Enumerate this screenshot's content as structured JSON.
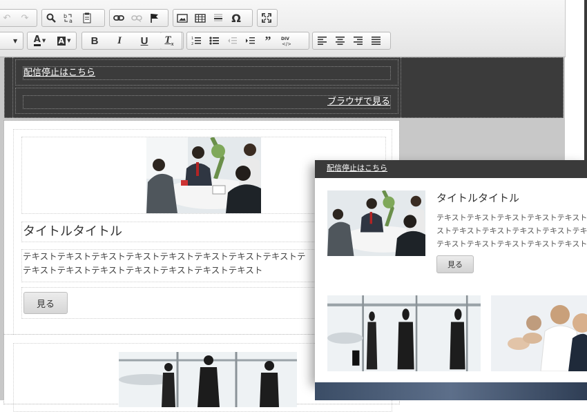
{
  "toolbar": {
    "row1": [
      {
        "name": "undo-button",
        "icon": "undo-icon",
        "glyph": "↶",
        "disabled": true
      },
      {
        "name": "redo-button",
        "icon": "redo-icon",
        "glyph": "↷",
        "disabled": true
      },
      {
        "name": "find-button",
        "icon": "search-icon",
        "glyph": "search"
      },
      {
        "name": "replace-button",
        "icon": "replace-icon",
        "glyph": "b→a"
      },
      {
        "name": "paste-from-word-button",
        "icon": "paste-icon",
        "glyph": "paste"
      },
      {
        "name": "link-button",
        "icon": "link-icon",
        "glyph": "link"
      },
      {
        "name": "unlink-button",
        "icon": "unlink-icon",
        "glyph": "unlink",
        "disabled": true
      },
      {
        "name": "anchor-button",
        "icon": "flag-icon",
        "glyph": "flag"
      },
      {
        "name": "image-button",
        "icon": "image-icon",
        "glyph": "image"
      },
      {
        "name": "table-button",
        "icon": "table-icon",
        "glyph": "table"
      },
      {
        "name": "horizontal-rule-button",
        "icon": "horizontal-rule-icon",
        "glyph": "hr"
      },
      {
        "name": "special-char-button",
        "icon": "omega-icon",
        "glyph": "Ω"
      },
      {
        "name": "maximize-button",
        "icon": "maximize-icon",
        "glyph": "max"
      }
    ],
    "row2": [
      {
        "name": "text-color-button",
        "icon": "text-color-icon",
        "glyph": "A",
        "dropdown": true
      },
      {
        "name": "bg-color-button",
        "icon": "bg-color-icon",
        "glyph": "A",
        "dropdown": true
      },
      {
        "name": "bold-button",
        "icon": "bold-icon",
        "glyph": "B"
      },
      {
        "name": "italic-button",
        "icon": "italic-icon",
        "glyph": "I"
      },
      {
        "name": "underline-button",
        "icon": "underline-icon",
        "glyph": "U"
      },
      {
        "name": "strike-button",
        "icon": "strikethrough-icon",
        "glyph": "S"
      },
      {
        "name": "remove-format-button",
        "icon": "remove-format-icon",
        "glyph": "Tx"
      },
      {
        "name": "numbered-list-button",
        "icon": "numbered-list-icon",
        "glyph": "ol"
      },
      {
        "name": "bulleted-list-button",
        "icon": "bulleted-list-icon",
        "glyph": "ul"
      },
      {
        "name": "outdent-button",
        "icon": "outdent-icon",
        "glyph": "out",
        "disabled": true
      },
      {
        "name": "indent-button",
        "icon": "indent-icon",
        "glyph": "in"
      },
      {
        "name": "blockquote-button",
        "icon": "quote-icon",
        "glyph": "99"
      },
      {
        "name": "div-button",
        "icon": "div-icon",
        "glyph": "div"
      },
      {
        "name": "align-left-button",
        "icon": "align-left-icon",
        "glyph": "al"
      },
      {
        "name": "align-center-button",
        "icon": "align-center-icon",
        "glyph": "ac"
      },
      {
        "name": "align-right-button",
        "icon": "align-right-icon",
        "glyph": "ar"
      },
      {
        "name": "justify-button",
        "icon": "align-justify-icon",
        "glyph": "aj"
      }
    ]
  },
  "editor": {
    "unsubscribe_link": "配信停止はこちら",
    "browser_link": "ブラウザで見る",
    "article": {
      "title": "タイトルタイトル",
      "text_line1": "テキストテキストテキストテキストテキストテキストテキストテキストテ",
      "text_line2": "テキストテキストテキストテキストテキストテキストテキスト",
      "button_label": "見る"
    }
  },
  "preview": {
    "unsubscribe_link": "配信停止はこちら",
    "title": "タイトルタイトル",
    "text_line1": "テキストテキストテキストテキストテキスト",
    "text_line2": "ストテキストテキストテキストテキストテキス",
    "text_line3": "テキストテキストテキストテキストテキスト",
    "button_label": "見る"
  },
  "colors": {
    "dark_header": "#3b3b3b",
    "canvas_bg": "#c8c8c8",
    "toolbar_bg": "#eeeeee"
  }
}
